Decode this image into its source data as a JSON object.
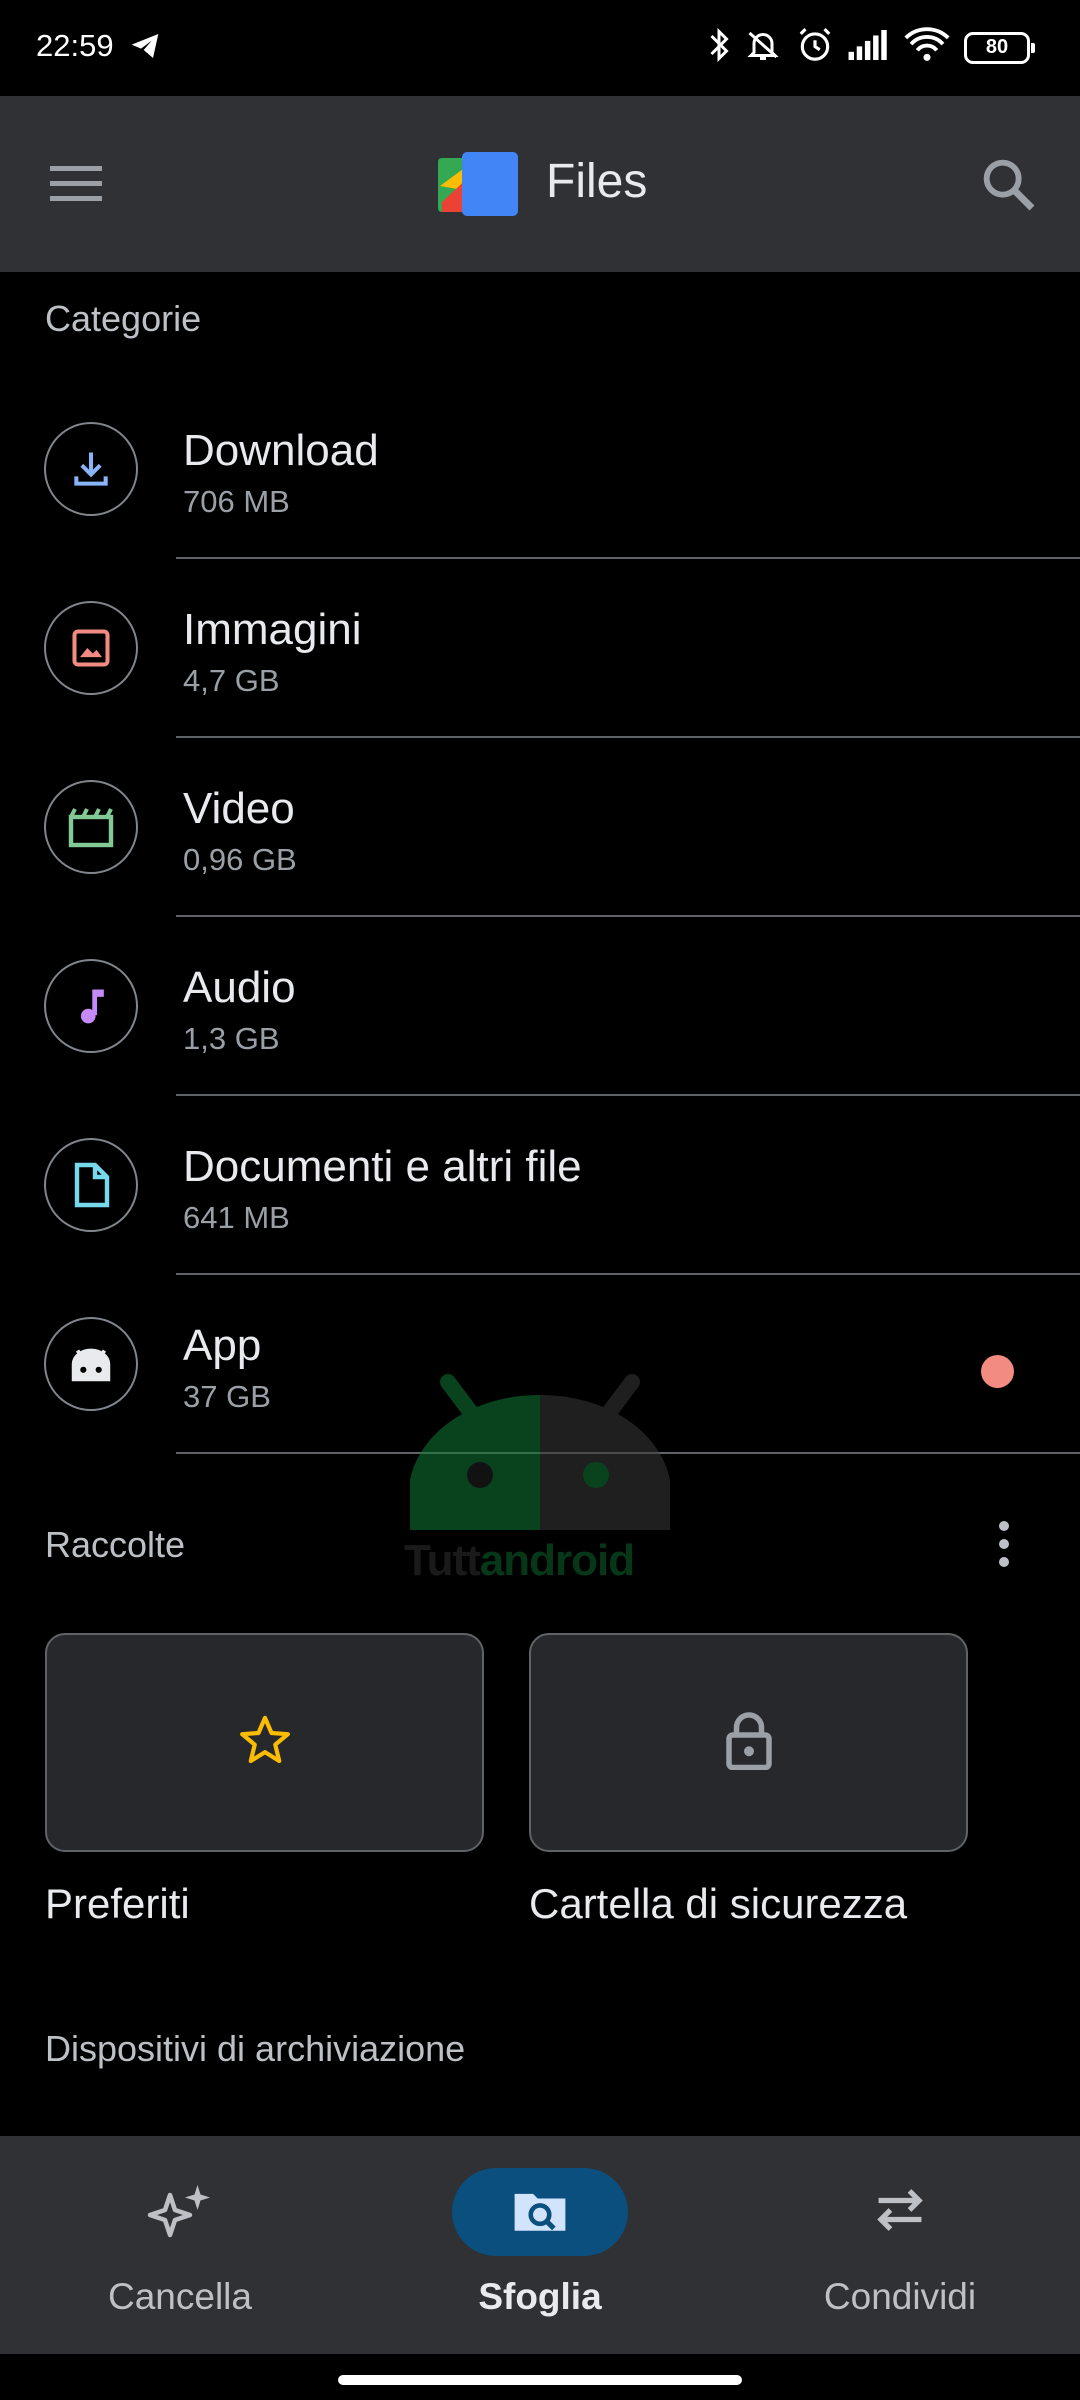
{
  "status_bar": {
    "time": "22:59",
    "battery": "80",
    "icons": [
      "telegram-icon",
      "bluetooth-icon",
      "mute-icon",
      "alarm-icon",
      "signal-icon",
      "wifi-icon",
      "battery-icon"
    ]
  },
  "app_bar": {
    "title": "Files",
    "menu_icon": "menu-icon",
    "search_icon": "search-icon"
  },
  "categories": {
    "heading": "Categorie",
    "items": [
      {
        "name": "Download",
        "size": "706 MB",
        "icon": "download-icon",
        "color": "#8ab4f8"
      },
      {
        "name": "Immagini",
        "size": "4,7 GB",
        "icon": "image-icon",
        "color": "#f28b82"
      },
      {
        "name": "Video",
        "size": "0,96 GB",
        "icon": "video-icon",
        "color": "#81c995"
      },
      {
        "name": "Audio",
        "size": "1,3 GB",
        "icon": "audio-icon",
        "color": "#c58af9"
      },
      {
        "name": "Documenti e altri file",
        "size": "641 MB",
        "icon": "document-icon",
        "color": "#78d9ec"
      },
      {
        "name": "App",
        "size": "37 GB",
        "icon": "android-icon",
        "color": "#e8eaed",
        "badge_color": "#f28b82"
      }
    ]
  },
  "collections": {
    "heading": "Raccolte",
    "items": [
      {
        "label": "Preferiti",
        "icon": "star-icon",
        "color": "#fbbc04"
      },
      {
        "label": "Cartella di sicurezza",
        "icon": "lock-icon",
        "color": "#9aa0a6"
      }
    ]
  },
  "storage": {
    "heading": "Dispositivi di archiviazione"
  },
  "bottom_nav": {
    "items": [
      {
        "label": "Cancella",
        "icon": "sparkle-icon",
        "active": false
      },
      {
        "label": "Sfoglia",
        "icon": "browse-icon",
        "active": true
      },
      {
        "label": "Condividi",
        "icon": "swap-icon",
        "active": false
      }
    ],
    "active_color": "#0b4f7f"
  },
  "watermark": {
    "part1": "Tutt",
    "part2": "android"
  }
}
